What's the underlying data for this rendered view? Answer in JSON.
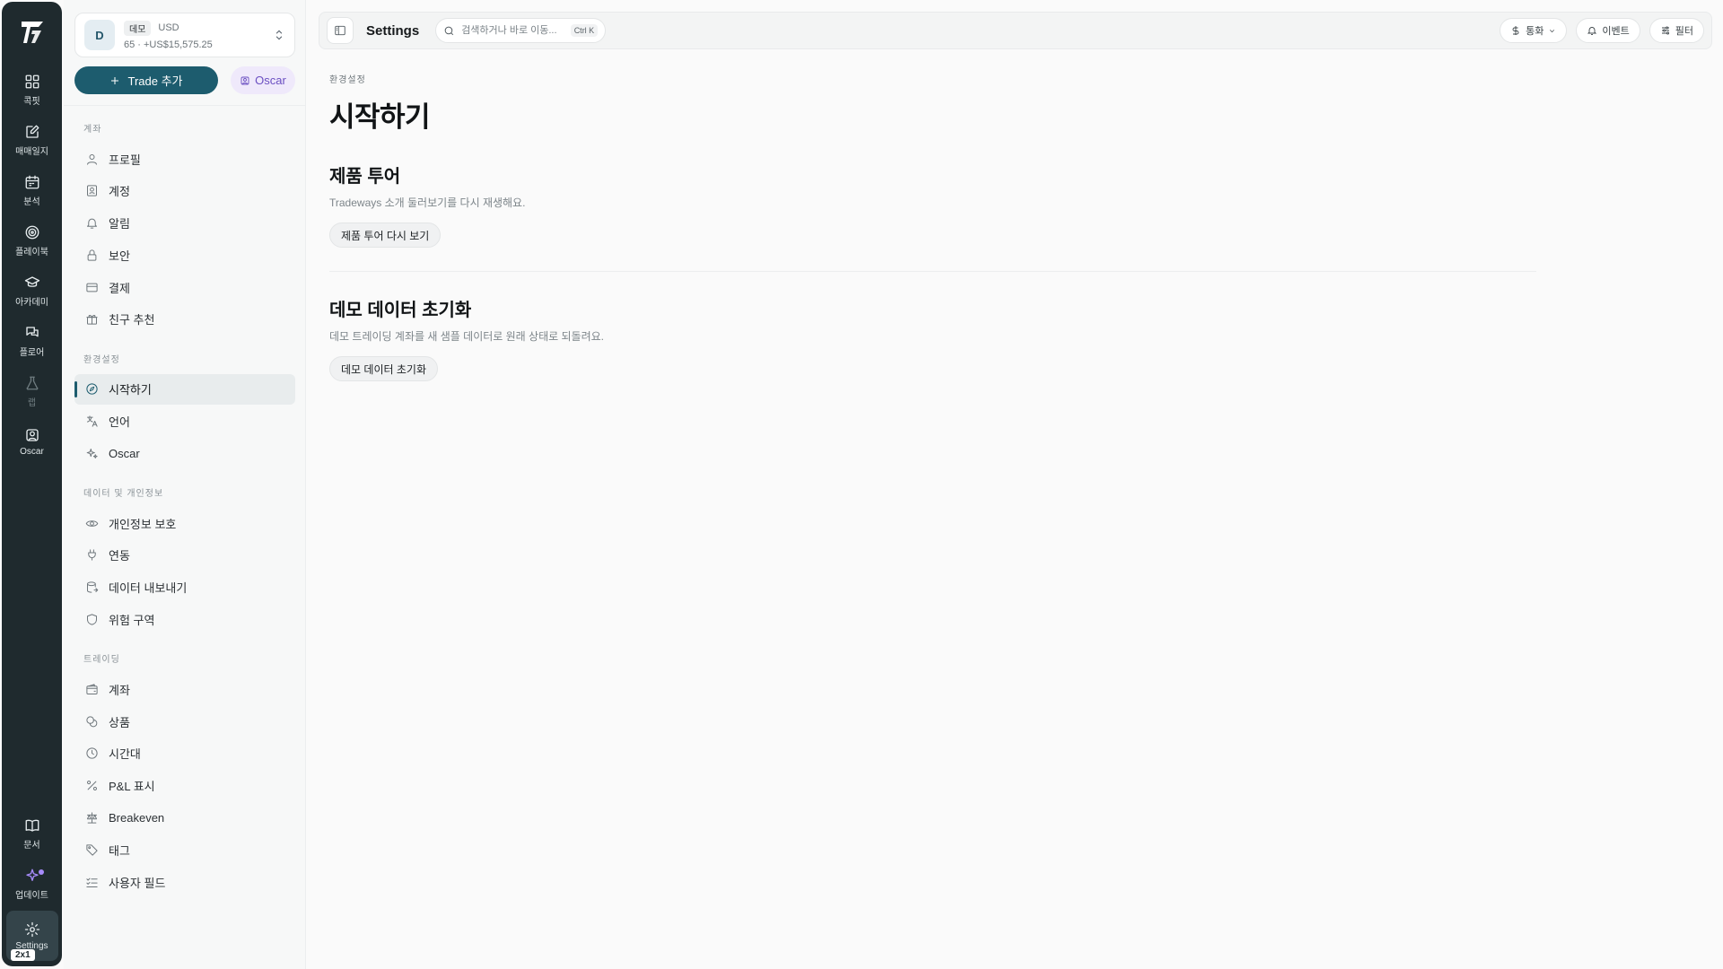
{
  "rail": {
    "items": [
      {
        "label": "콕핏",
        "icon": "dashboard-icon"
      },
      {
        "label": "매매일지",
        "icon": "journal-icon"
      },
      {
        "label": "분석",
        "icon": "calendar-icon"
      },
      {
        "label": "플레이북",
        "icon": "target-icon"
      },
      {
        "label": "아카데미",
        "icon": "graduation-cap-icon"
      },
      {
        "label": "플로어",
        "icon": "chat-icon"
      },
      {
        "label": "랩",
        "icon": "flask-icon"
      },
      {
        "label": "Oscar",
        "icon": "oscar-icon"
      }
    ],
    "bottom": [
      {
        "label": "문서",
        "icon": "book-icon"
      },
      {
        "label": "업데이트",
        "icon": "sparkle-icon"
      },
      {
        "label": "Settings",
        "icon": "gear-icon"
      }
    ],
    "badge": "2x1"
  },
  "account": {
    "avatar": "D",
    "name": "데모",
    "currency": "USD",
    "summary": "65 · +US$15,575.25"
  },
  "actions": {
    "trade_label": "Trade 추가",
    "oscar_label": "Oscar"
  },
  "nav": {
    "sections": [
      {
        "title": "계좌",
        "items": [
          "프로필",
          "계정",
          "알림",
          "보안",
          "결제",
          "친구 추천"
        ]
      },
      {
        "title": "환경설정",
        "items": [
          "시작하기",
          "언어",
          "Oscar"
        ]
      },
      {
        "title": "데이터 및 개인정보",
        "items": [
          "개인정보 보호",
          "연동",
          "데이터 내보내기",
          "위험 구역"
        ]
      },
      {
        "title": "트레이딩",
        "items": [
          "계좌",
          "상품",
          "시간대",
          "P&L 표시",
          "Breakeven",
          "태그",
          "사용자 필드"
        ]
      }
    ],
    "active": "시작하기"
  },
  "topbar": {
    "title": "Settings",
    "search_placeholder": "검색하거나 바로 이동...",
    "search_shortcut": "Ctrl K",
    "currency_label": "통화",
    "events_label": "이벤트",
    "filter_label": "필터"
  },
  "main": {
    "eyebrow": "환경설정",
    "title": "시작하기",
    "tour": {
      "title": "제품 투어",
      "desc": "Tradeways 소개 둘러보기를 다시 재생해요.",
      "button": "제품 투어 다시 보기"
    },
    "reset": {
      "title": "데모 데이터 초기화",
      "desc": "데모 트레이딩 계좌를 새 샘플 데이터로 원래 상태로 되돌려요.",
      "button": "데모 데이터 초기화"
    }
  },
  "colors": {
    "accent": "#1d5c6e",
    "rail_bg": "#1f2a2e",
    "oscar_purple": "#6b4fc2"
  }
}
